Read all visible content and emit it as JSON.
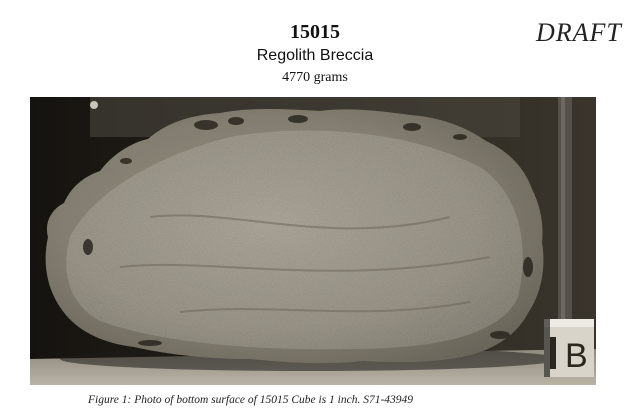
{
  "header": {
    "sample_number": "15015",
    "rock_type": "Regolith Breccia",
    "mass": "4770 grams",
    "watermark": "DRAFT"
  },
  "figure": {
    "caption": "Figure 1:  Photo of bottom surface of 15015  Cube is 1 inch.  S71-43949",
    "cube_label": "B"
  }
}
